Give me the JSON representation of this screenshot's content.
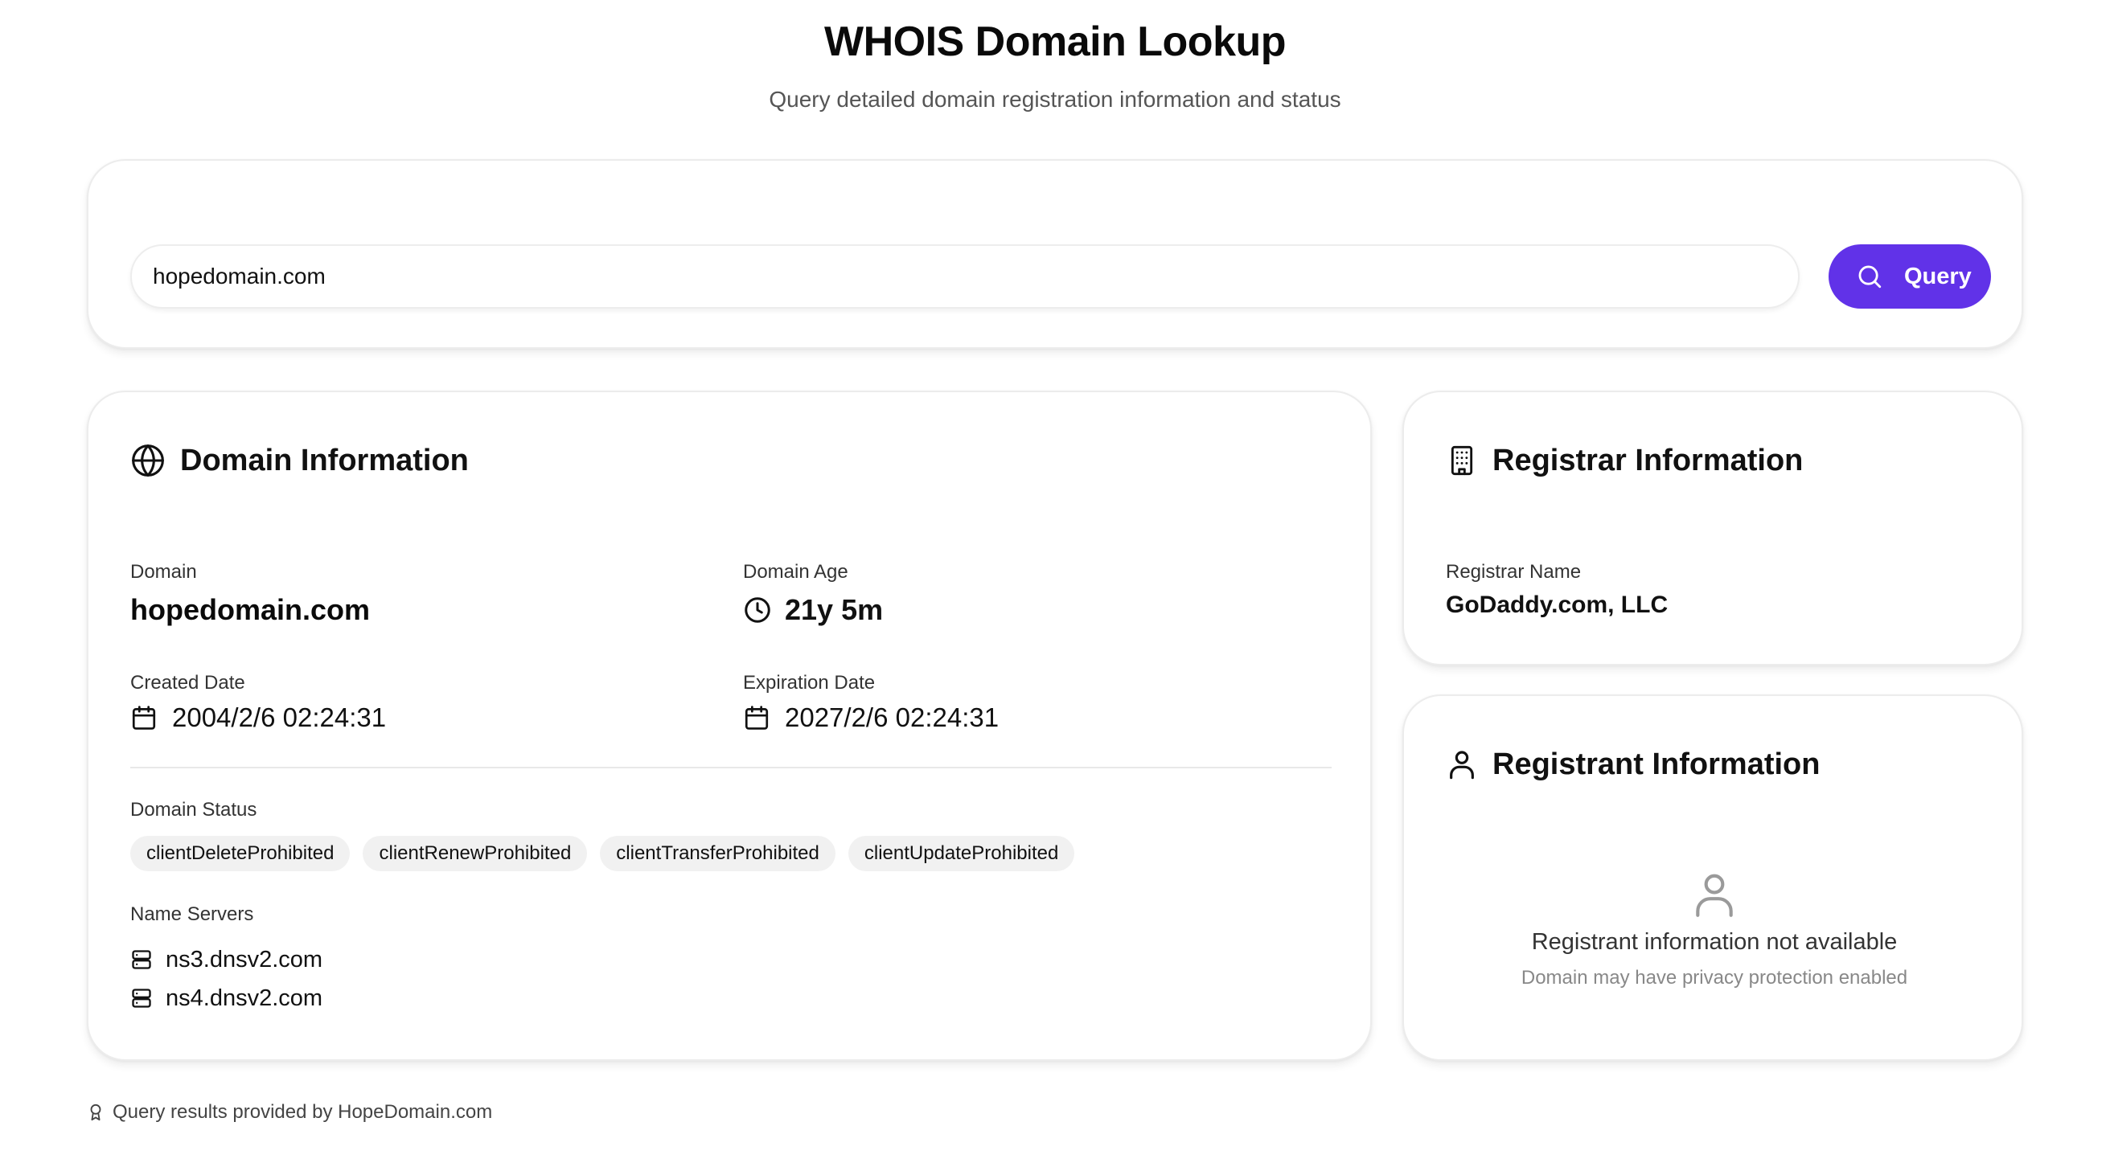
{
  "header": {
    "title": "WHOIS Domain Lookup",
    "subtitle": "Query detailed domain registration information and status"
  },
  "search": {
    "value": "hopedomain.com",
    "button_label": "Query",
    "button_icon": "search-icon",
    "accent_color": "#6132e8"
  },
  "domain_info": {
    "title": "Domain Information",
    "title_icon": "globe-icon",
    "domain_label": "Domain",
    "domain_value": "hopedomain.com",
    "age_label": "Domain Age",
    "age_value": "21y 5m",
    "age_icon": "clock-icon",
    "created_label": "Created Date",
    "created_value": "2004/2/6 02:24:31",
    "expiration_label": "Expiration Date",
    "expiration_value": "2027/2/6 02:24:31",
    "date_icon": "calendar-icon",
    "status_label": "Domain Status",
    "statuses": [
      "clientDeleteProhibited",
      "clientRenewProhibited",
      "clientTransferProhibited",
      "clientUpdateProhibited"
    ],
    "nameservers_label": "Name Servers",
    "nameserver_icon": "server-icon",
    "nameservers": [
      "ns3.dnsv2.com",
      "ns4.dnsv2.com"
    ]
  },
  "registrar": {
    "title": "Registrar Information",
    "title_icon": "building-icon",
    "name_label": "Registrar Name",
    "name_value": "GoDaddy.com, LLC"
  },
  "registrant": {
    "title": "Registrant Information",
    "title_icon": "user-icon",
    "empty_icon": "user-placeholder-icon",
    "empty_title": "Registrant information not available",
    "empty_subtitle": "Domain may have privacy protection enabled"
  },
  "footer": {
    "icon": "award-icon",
    "text": "Query results provided by HopeDomain.com"
  }
}
